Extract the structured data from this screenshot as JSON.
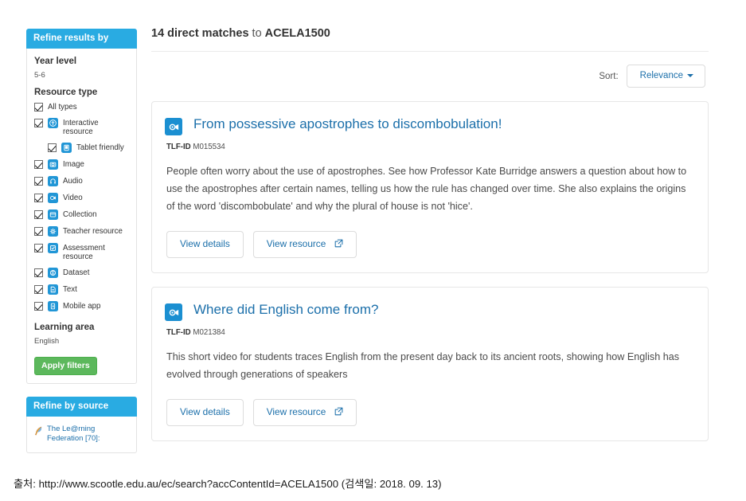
{
  "sidebar": {
    "refine_results": {
      "title": "Refine results by",
      "year_level_label": "Year level",
      "year_level_value": "5-6",
      "resource_type_label": "Resource type",
      "options": [
        {
          "label": "All types",
          "icon": "",
          "indent": false,
          "checked": true
        },
        {
          "label": "Interactive resource",
          "icon": "interactive-resource-icon",
          "indent": false,
          "checked": true
        },
        {
          "label": "Tablet friendly",
          "icon": "tablet-friendly-icon",
          "indent": true,
          "checked": true
        },
        {
          "label": "Image",
          "icon": "image-icon",
          "indent": false,
          "checked": true
        },
        {
          "label": "Audio",
          "icon": "audio-icon",
          "indent": false,
          "checked": true
        },
        {
          "label": "Video",
          "icon": "video-icon",
          "indent": false,
          "checked": true
        },
        {
          "label": "Collection",
          "icon": "collection-icon",
          "indent": false,
          "checked": true
        },
        {
          "label": "Teacher resource",
          "icon": "teacher-resource-icon",
          "indent": false,
          "checked": true
        },
        {
          "label": "Assessment resource",
          "icon": "assessment-resource-icon",
          "indent": false,
          "checked": true
        },
        {
          "label": "Dataset",
          "icon": "dataset-icon",
          "indent": false,
          "checked": true
        },
        {
          "label": "Text",
          "icon": "text-icon",
          "indent": false,
          "checked": true
        },
        {
          "label": "Mobile app",
          "icon": "mobile-app-icon",
          "indent": false,
          "checked": true
        }
      ],
      "learning_area_label": "Learning area",
      "learning_area_value": "English",
      "apply_label": "Apply filters"
    },
    "refine_source": {
      "title": "Refine by source",
      "items": [
        {
          "label": "The Le@rning Federation [70]:",
          "icon": "quill-icon"
        }
      ]
    }
  },
  "main": {
    "results_count": "14 direct matches",
    "results_to": " to ",
    "results_query": "ACELA1500",
    "sort_label": "Sort:",
    "sort_value": "Relevance",
    "results": [
      {
        "icon": "video-resource-icon",
        "title": "From possessive apostrophes to discombobulation!",
        "tlf_label": "TLF-ID",
        "tlf_id": "M015534",
        "description": "People often worry about the use of apostrophes. See how Professor Kate Burridge answers a question about how to use the apostrophes after certain names, telling us how the rule has changed over time. She also explains the origins of the word 'discombobulate' and why the plural of house is not 'hice'.",
        "view_details_label": "View details",
        "view_resource_label": "View resource"
      },
      {
        "icon": "video-resource-icon",
        "title": "Where did English come from?",
        "tlf_label": "TLF-ID",
        "tlf_id": "M021384",
        "description": "This short video for students traces English from the present day back to its ancient roots, showing how English has evolved through generations of speakers",
        "view_details_label": "View details",
        "view_resource_label": "View resource"
      }
    ]
  },
  "caption": "출처: http://www.scootle.edu.au/ec/search?accContentId=ACELA1500 (검색일: 2018. 09. 13)",
  "colors": {
    "header_blue": "#29abe2",
    "link_blue": "#1b6faa",
    "icon_blue": "#1b8fd1",
    "apply_green": "#5cb85c"
  }
}
